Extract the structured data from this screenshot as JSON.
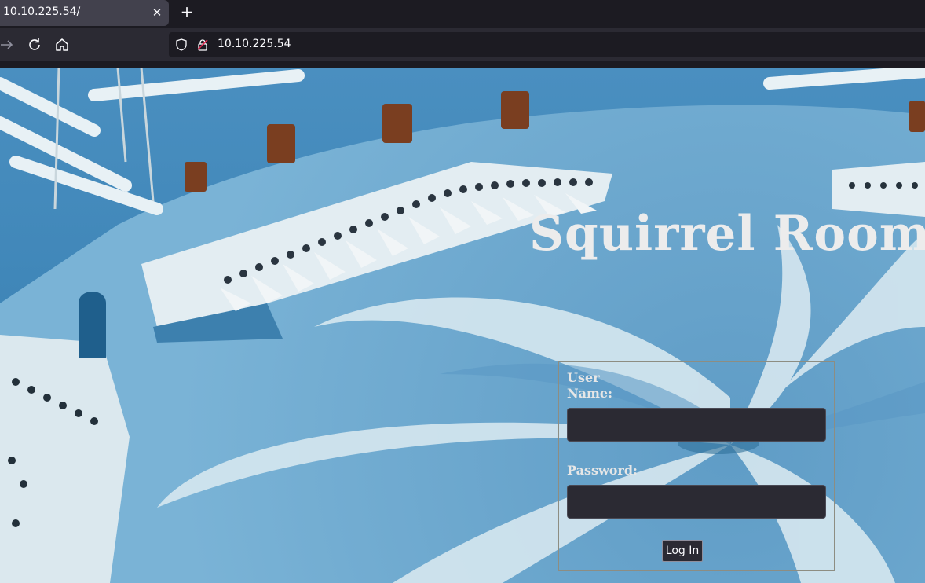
{
  "browser": {
    "tab": {
      "title": "10.10.225.54/",
      "close_icon": "close-icon"
    },
    "new_tab_icon": "plus-icon",
    "nav": {
      "forward_icon": "arrow-right-icon",
      "reload_icon": "reload-icon",
      "home_icon": "home-icon"
    },
    "url": {
      "text": "10.10.225.54",
      "shield_icon": "shield-icon",
      "lock_icon": "insecure-lock-icon"
    }
  },
  "page": {
    "title": "Squirrel Room",
    "login": {
      "username_label": "User Name:",
      "username_value": "",
      "password_label": "Password:",
      "password_value": "",
      "submit_label": "Log In"
    },
    "background": {
      "description_icon": "chocolate-room-photo"
    }
  },
  "colors": {
    "chrome_dark": "#1c1b22",
    "chrome_mid": "#2b2a33",
    "tab_active": "#42414d",
    "floor_blue": "#6aa6cf",
    "floor_light": "#d6e6ef",
    "title_text": "#ececec"
  }
}
